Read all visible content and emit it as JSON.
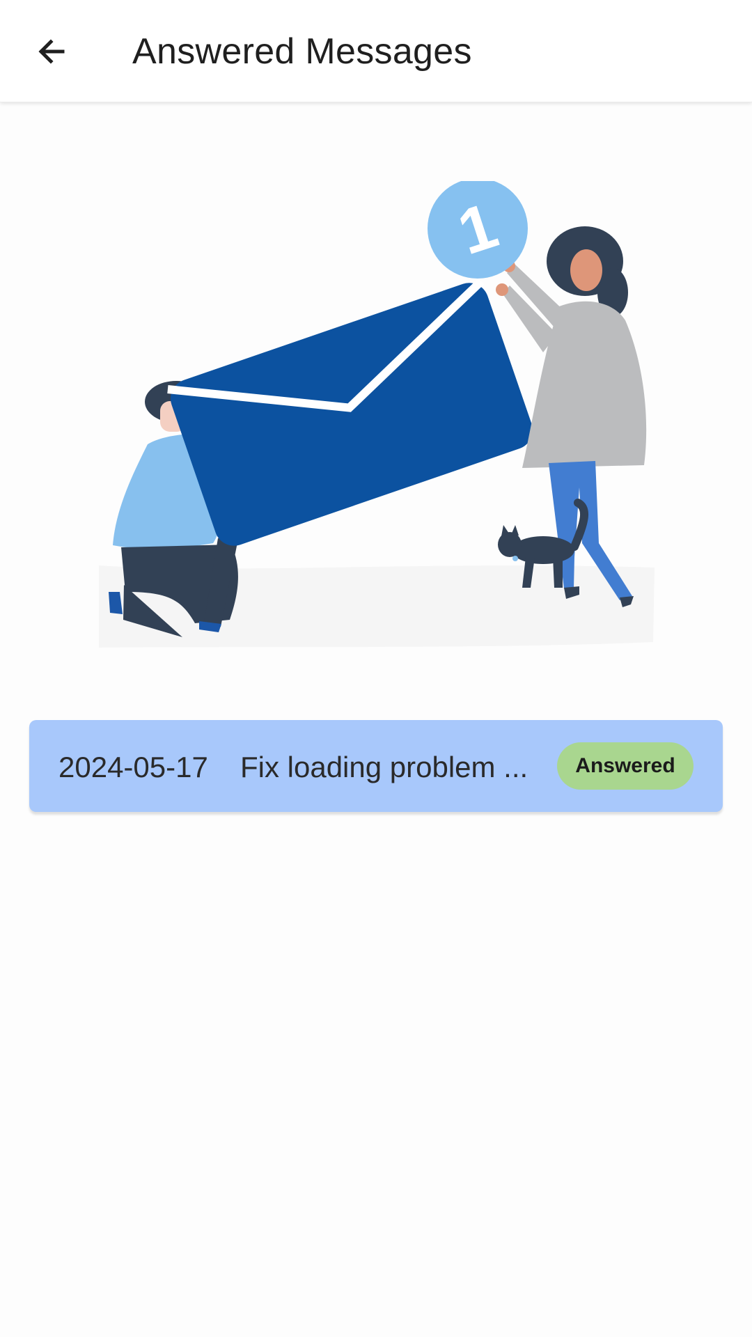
{
  "header": {
    "title": "Answered Messages",
    "back_icon": "arrow-left-icon"
  },
  "illustration": {
    "notification_count": "1",
    "colors": {
      "envelope": "#0c52a0",
      "badge": "#86c1f0",
      "ground": "#f5f5f5"
    }
  },
  "messages": [
    {
      "date": "2024-05-17",
      "subject": "Fix loading problem ...",
      "status": "Answered"
    }
  ],
  "colors": {
    "card_background": "#a8c8fb",
    "status_badge": "#a9d68f"
  }
}
